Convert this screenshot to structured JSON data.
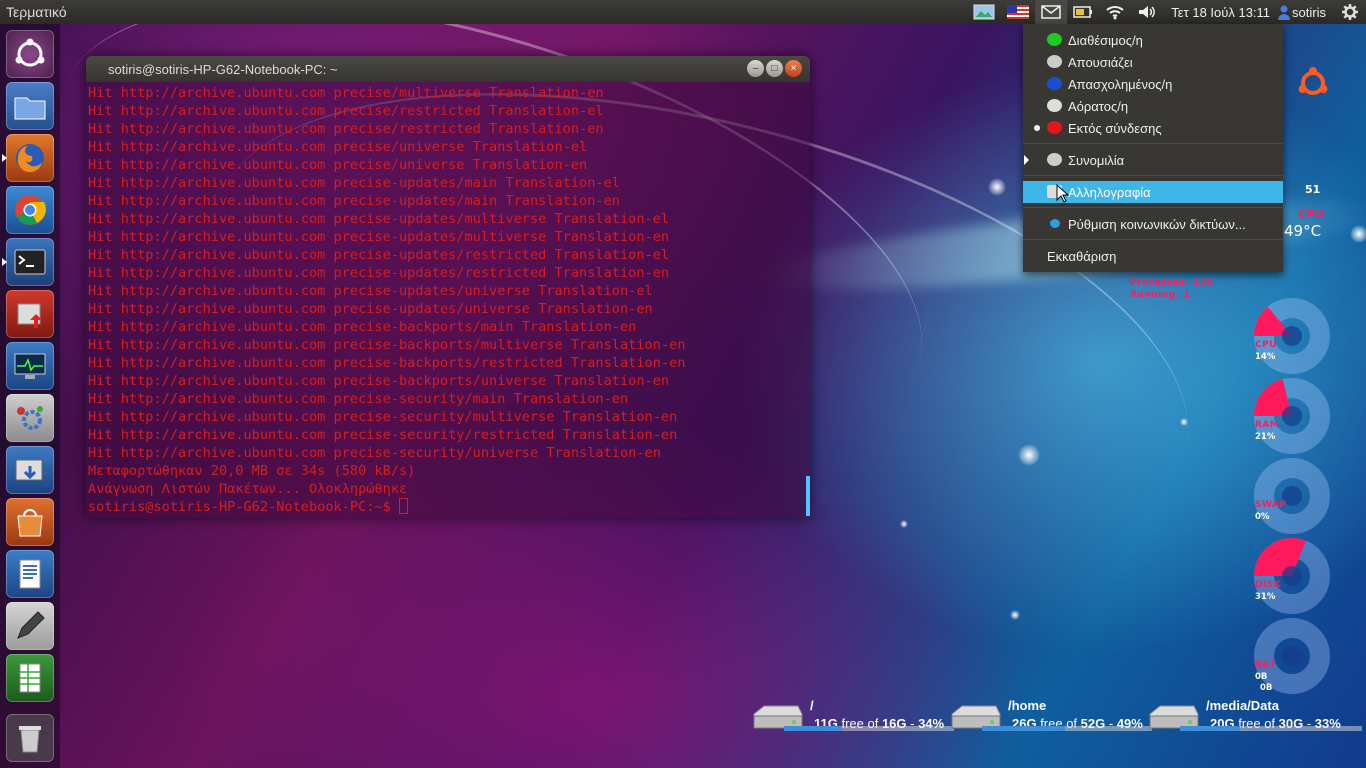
{
  "top_panel": {
    "app_title": "Τερματικό",
    "clock": "Τετ 18 Ιούλ 13:11",
    "user": "sotiris"
  },
  "terminal": {
    "title": "sotiris@sotiris-HP-G62-Notebook-PC: ~",
    "lines": [
      "Hit http://archive.ubuntu.com precise/multiverse Translation-en",
      "Hit http://archive.ubuntu.com precise/restricted Translation-el",
      "Hit http://archive.ubuntu.com precise/restricted Translation-en",
      "Hit http://archive.ubuntu.com precise/universe Translation-el",
      "Hit http://archive.ubuntu.com precise/universe Translation-en",
      "Hit http://archive.ubuntu.com precise-updates/main Translation-el",
      "Hit http://archive.ubuntu.com precise-updates/main Translation-en",
      "Hit http://archive.ubuntu.com precise-updates/multiverse Translation-el",
      "Hit http://archive.ubuntu.com precise-updates/multiverse Translation-en",
      "Hit http://archive.ubuntu.com precise-updates/restricted Translation-el",
      "Hit http://archive.ubuntu.com precise-updates/restricted Translation-en",
      "Hit http://archive.ubuntu.com precise-updates/universe Translation-el",
      "Hit http://archive.ubuntu.com precise-updates/universe Translation-en",
      "Hit http://archive.ubuntu.com precise-backports/main Translation-en",
      "Hit http://archive.ubuntu.com precise-backports/multiverse Translation-en",
      "Hit http://archive.ubuntu.com precise-backports/restricted Translation-en",
      "Hit http://archive.ubuntu.com precise-backports/universe Translation-en",
      "Hit http://archive.ubuntu.com precise-security/main Translation-en",
      "Hit http://archive.ubuntu.com precise-security/multiverse Translation-en",
      "Hit http://archive.ubuntu.com precise-security/restricted Translation-en",
      "Hit http://archive.ubuntu.com precise-security/universe Translation-en",
      "Μεταφορτώθηκαν 20,0 MB σε 34s (580 kB/s)",
      "Ανάγνωση Λιστών Πακέτων... Ολοκληρώθηκε"
    ],
    "prompt": "sotiris@sotiris-HP-G62-Notebook-PC:~$ "
  },
  "status_menu": {
    "available": "Διαθέσιμος/η",
    "away": "Απουσιάζει",
    "busy": "Απασχολημένος/η",
    "invisible": "Αόρατος/η",
    "offline": "Εκτός σύνδεσης",
    "chat": "Συνομιλία",
    "mail": "Αλληλογραφία",
    "social": "Ρύθμιση κοινωνικών δικτύων...",
    "clear": "Εκκαθάριση"
  },
  "conky": {
    "top_value": "51",
    "cpu_label_top": "CPU",
    "cpu_temp": "49°C",
    "processes": "Processes: 158",
    "running": "Running: 1",
    "gauges": [
      {
        "label": "CPU",
        "value": "14%",
        "fraction": 0.14
      },
      {
        "label": "RAM",
        "value": "21%",
        "fraction": 0.21
      },
      {
        "label": "SWAP",
        "value": "0%",
        "fraction": 0.0
      },
      {
        "label": "DISK",
        "value": "31%",
        "fraction": 0.31
      },
      {
        "label": "NET",
        "value": "0B",
        "value2": "0B",
        "fraction": 0.0
      }
    ]
  },
  "disks": [
    {
      "name": "/",
      "free": "11G",
      "total": "16G",
      "pct": "34%",
      "fraction": 0.34
    },
    {
      "name": "/home",
      "free": "26G",
      "total": "52G",
      "pct": "49%",
      "fraction": 0.49
    },
    {
      "name": "/media/Data",
      "free": "20G",
      "total": "30G",
      "pct": "33%",
      "fraction": 0.33
    }
  ],
  "disk_text": {
    "free_word": "free of",
    "sep": " - "
  },
  "colors": {
    "terminal_text": "#d41f1f",
    "menu_highlight": "#3fb6e8",
    "conky_accent": "#ff1a5e"
  }
}
